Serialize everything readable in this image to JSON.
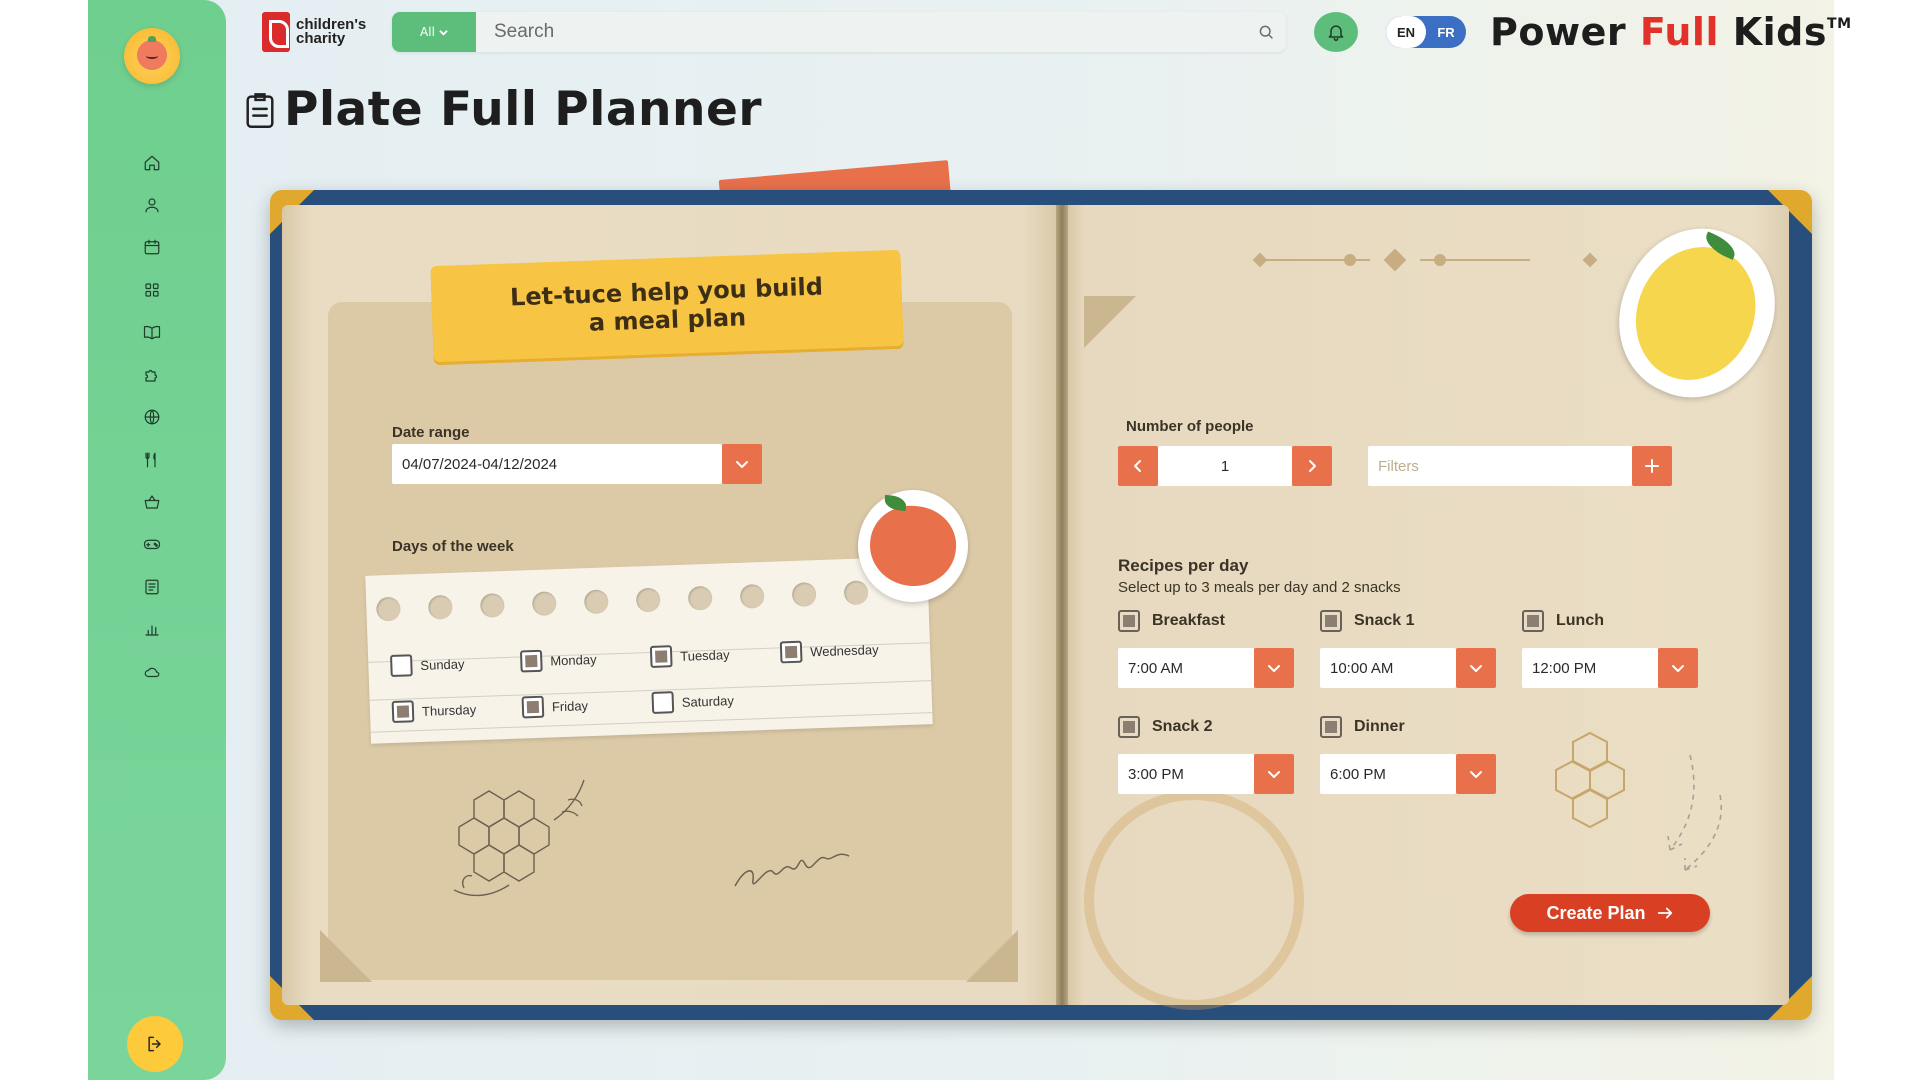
{
  "brand": {
    "logo_text": "children's charity"
  },
  "search": {
    "scope": "All",
    "placeholder": "Search"
  },
  "lang": {
    "en": "EN",
    "fr": "FR"
  },
  "site_title": {
    "part1": "Power ",
    "part2": "Full",
    "part3": " Kids",
    "tm": "TM"
  },
  "page": {
    "title": "Plate Full Planner"
  },
  "sidebar": {
    "items": [
      "home-icon",
      "user-icon",
      "calendar-icon",
      "grid-icon",
      "book-icon",
      "puzzle-icon",
      "globe-icon",
      "utensils-icon",
      "basket-icon",
      "gamepad-icon",
      "notes-icon",
      "chart-icon",
      "cloud-icon"
    ]
  },
  "planner": {
    "banner": "Let-tuce help you build a meal plan",
    "date_range": {
      "label": "Date range",
      "value": "04/07/2024-04/12/2024"
    },
    "days": {
      "label": "Days of the week",
      "items": [
        {
          "name": "Sunday",
          "checked": false
        },
        {
          "name": "Monday",
          "checked": true
        },
        {
          "name": "Tuesday",
          "checked": true
        },
        {
          "name": "Wednesday",
          "checked": true
        },
        {
          "name": "Thursday",
          "checked": true
        },
        {
          "name": "Friday",
          "checked": true
        },
        {
          "name": "Saturday",
          "checked": false
        }
      ]
    },
    "people": {
      "label": "Number of people",
      "value": "1"
    },
    "filters": {
      "placeholder": "Filters"
    },
    "recipes": {
      "title": "Recipes per day",
      "subtitle": "Select up to 3 meals per day and 2 snacks",
      "meals": [
        {
          "name": "Breakfast",
          "time": "7:00 AM"
        },
        {
          "name": "Snack 1",
          "time": "10:00 AM"
        },
        {
          "name": "Lunch",
          "time": "12:00 PM"
        },
        {
          "name": "Snack 2",
          "time": "3:00 PM"
        },
        {
          "name": "Dinner",
          "time": "6:00 PM"
        }
      ]
    },
    "create_label": "Create Plan"
  },
  "colors": {
    "green": "#6fcf8e",
    "orange": "#e8714c",
    "red": "#d93f22",
    "yellow": "#f7c443",
    "book_blue": "#284e7c"
  }
}
